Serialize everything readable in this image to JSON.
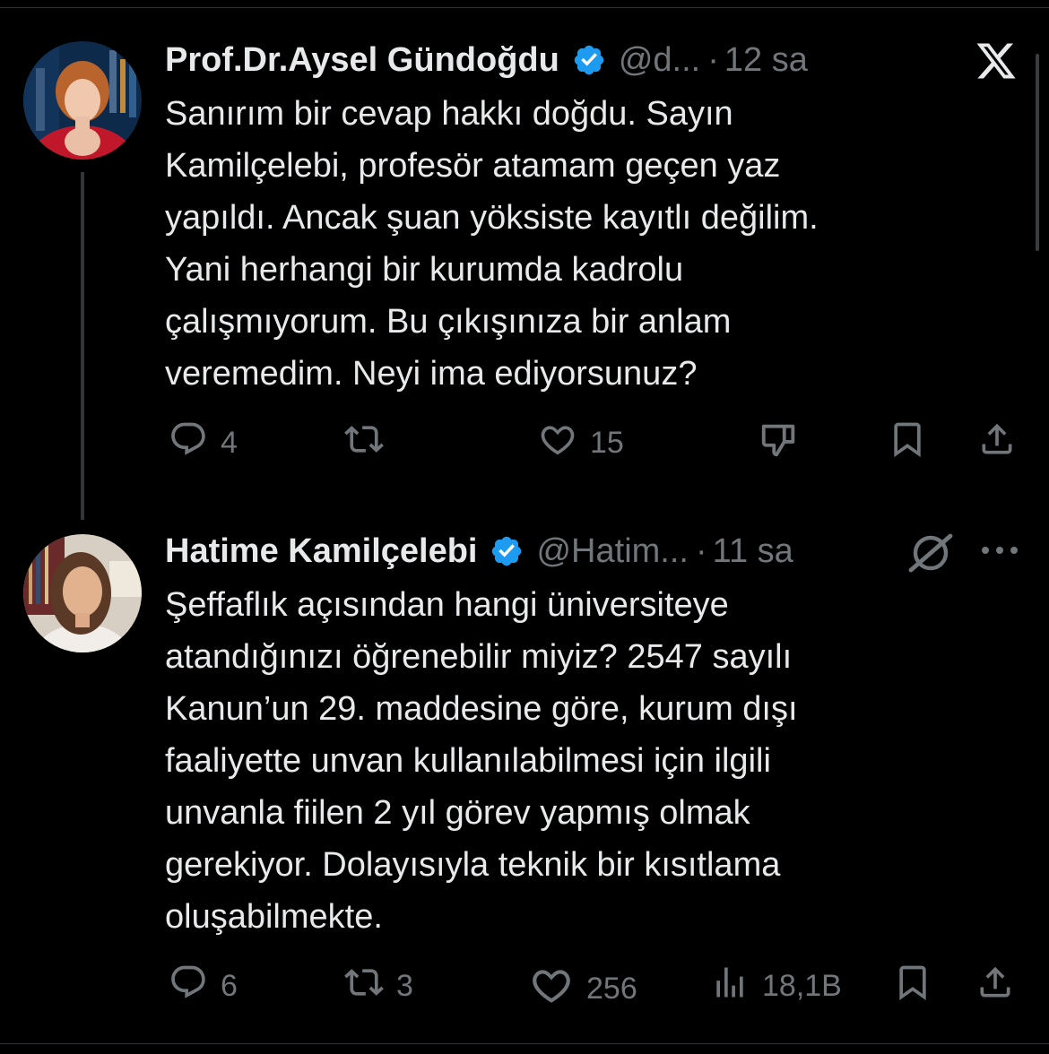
{
  "tweets": [
    {
      "name": "Prof.Dr.Aysel Gündoğdu",
      "handle": "@d...",
      "separator": "·",
      "time": "12 sa",
      "lines": [
        "Sanırım bir cevap hakkı doğdu. Sayın",
        "Kamilçelebi, profesör atamam geçen yaz",
        "yapıldı. Ancak şuan yöksiste kayıtlı değilim.",
        "Yani herhangi bir kurumda kadrolu",
        "çalışmıyorum. Bu çıkışınıza bir anlam",
        "veremedim. Neyi ima ediyorsunuz?"
      ],
      "reply_count": "4",
      "retweet_count": "",
      "like_count": "15"
    },
    {
      "name": "Hatime Kamilçelebi",
      "handle": "@Hatim...",
      "separator": "·",
      "time": "11 sa",
      "lines": [
        "Şeffaflık açısından hangi üniversiteye",
        "atandığınızı öğrenebilir miyiz? 2547 sayılı",
        "Kanun’un 29. maddesine göre, kurum dışı",
        "faaliyette unvan kullanılabilmesi için ilgili",
        "unvanla fiilen 2 yıl görev yapmış olmak",
        "gerekiyor. Dolayısıyla teknik bir kısıtlama",
        "oluşabilmekte."
      ],
      "reply_count": "6",
      "retweet_count": "3",
      "like_count": "256",
      "view_count": "18,1B"
    }
  ],
  "icons": {
    "close": "x-logo-icon",
    "more": "more-dots-icon",
    "grok": "grok-icon",
    "verified": "verified-badge-icon",
    "reply": "reply-icon",
    "retweet": "retweet-icon",
    "like": "like-icon",
    "dislike": "dislike-icon",
    "views": "views-icon",
    "bookmark": "bookmark-icon",
    "share": "share-icon"
  },
  "colors": {
    "background": "#000000",
    "text": "#e7e9ea",
    "muted": "#71767b",
    "verified": "#1d9bf0"
  }
}
